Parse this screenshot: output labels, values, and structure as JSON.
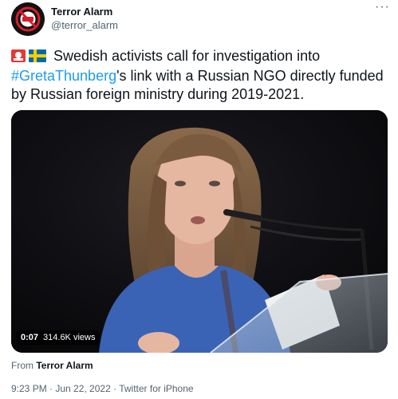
{
  "author": {
    "name": "Terror Alarm",
    "handle": "@terror_alarm",
    "avatar_label": "TERROR ALARM"
  },
  "more_label": "···",
  "tweet": {
    "text_before": " Swedish activists call for investigation into ",
    "hashtag": "#GretaThunberg",
    "text_after": "'s  link with a Russian NGO directly funded by Russian foreign ministry during 2019-2021."
  },
  "video": {
    "duration": "0:07",
    "views": "314.6K views"
  },
  "source": {
    "prefix": "From ",
    "name": "Terror Alarm"
  },
  "meta": {
    "time": "9:23 PM · Jun 22, 2022 · Twitter for iPhone"
  },
  "icons": {
    "alarm": "rotating-light-icon",
    "flag": "sweden-flag-icon"
  },
  "colors": {
    "link": "#1d9bf0",
    "secondary": "#536471",
    "text": "#0f1419"
  }
}
